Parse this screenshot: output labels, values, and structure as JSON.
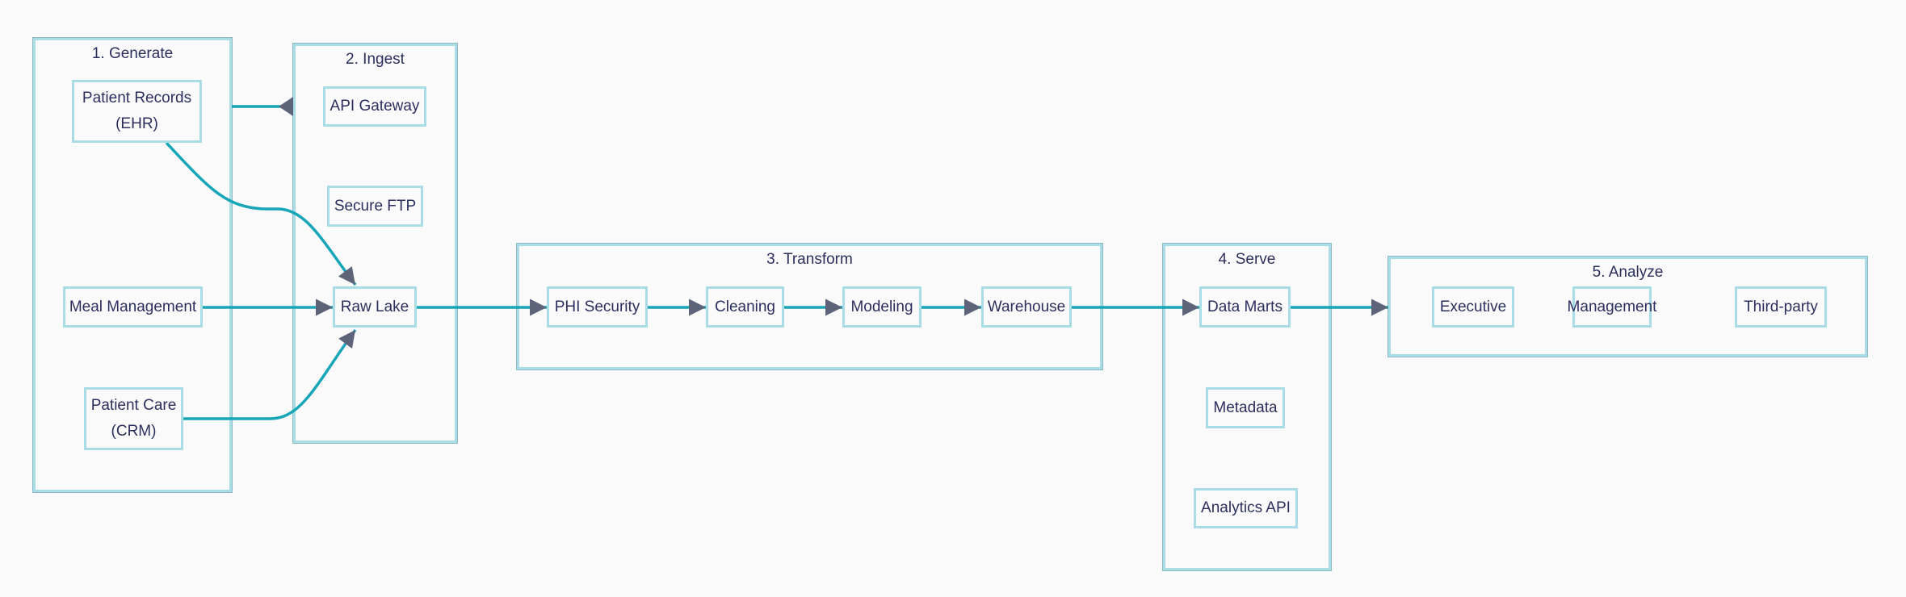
{
  "colors": {
    "border": "#a9dce5",
    "edge": "#17a6b8",
    "arrowhead": "#5d6479",
    "text": "#2b2f5e"
  },
  "clusters": {
    "generate": {
      "title": "1. Generate"
    },
    "ingest": {
      "title": "2. Ingest"
    },
    "transform": {
      "title": "3. Transform"
    },
    "serve": {
      "title": "4. Serve"
    },
    "analyze": {
      "title": "5. Analyze"
    }
  },
  "nodes": {
    "ehr": "Patient Records\n(EHR)",
    "meal": "Meal Management",
    "crm": "Patient Care\n(CRM)",
    "api_gateway": "API Gateway",
    "sftp": "Secure FTP",
    "raw_lake": "Raw Lake",
    "phi": "PHI Security",
    "cleaning": "Cleaning",
    "modeling": "Modeling",
    "warehouse": "Warehouse",
    "data_marts": "Data Marts",
    "metadata": "Metadata",
    "analytics_api": "Analytics API",
    "executive": "Executive",
    "management": "Management",
    "third_party": "Third-party"
  },
  "edges": [
    {
      "from": "Patient Records (EHR)",
      "to": "2. Ingest"
    },
    {
      "from": "Patient Records (EHR)",
      "to": "Raw Lake"
    },
    {
      "from": "Meal Management",
      "to": "Raw Lake"
    },
    {
      "from": "Patient Care (CRM)",
      "to": "Raw Lake"
    },
    {
      "from": "Raw Lake",
      "to": "PHI Security"
    },
    {
      "from": "PHI Security",
      "to": "Cleaning"
    },
    {
      "from": "Cleaning",
      "to": "Modeling"
    },
    {
      "from": "Modeling",
      "to": "Warehouse"
    },
    {
      "from": "Warehouse",
      "to": "Data Marts"
    },
    {
      "from": "Data Marts",
      "to": "5. Analyze"
    }
  ]
}
